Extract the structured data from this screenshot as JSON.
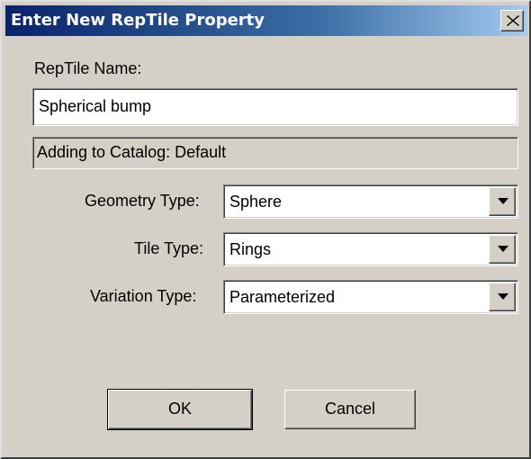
{
  "window": {
    "title": "Enter New RepTile Property"
  },
  "form": {
    "name_label": "RepTile Name:",
    "name_value": "Spherical bump",
    "catalog_text": "Adding to Catalog: Default",
    "geometry_label": "Geometry Type:",
    "geometry_value": "Sphere",
    "tile_label": "Tile Type:",
    "tile_value": "Rings",
    "variation_label": "Variation Type:",
    "variation_value": "Parameterized"
  },
  "buttons": {
    "ok": "OK",
    "cancel": "Cancel"
  },
  "icons": {
    "close": "close-icon",
    "dropdown": "chevron-down-icon"
  },
  "colors": {
    "title_start": "#0a246a",
    "title_end": "#a6caf0",
    "face": "#d4d0c8"
  }
}
